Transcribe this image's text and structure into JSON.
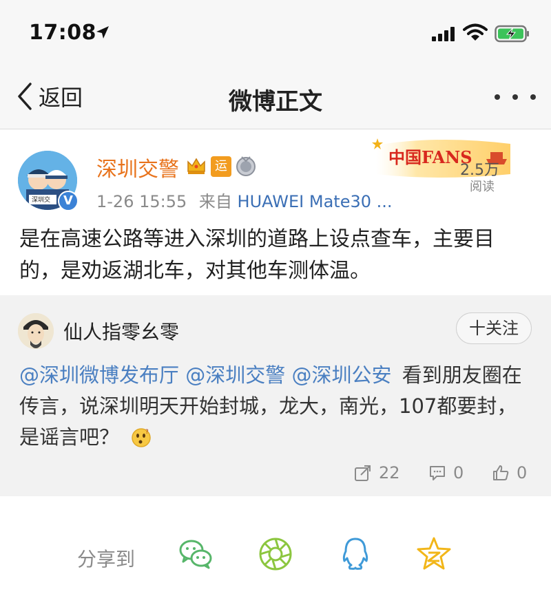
{
  "status_bar": {
    "time": "17:08"
  },
  "nav": {
    "back_label": "返回",
    "title": "微博正文"
  },
  "post": {
    "author": "深圳交警",
    "badge_yun": "运",
    "avatar_text": "深圳交",
    "verify_mark": "V",
    "time": "1-26 15:55",
    "source_prefix": "来自",
    "source": "HUAWEI Mate30 ...",
    "fans_banner_text": "中国FANS",
    "read_count": "2.5万",
    "read_label": "阅读",
    "text": "是在高速公路等进入深圳的道路上设点查车，主要目的，是劝返湖北车，对其他车测体温。"
  },
  "repost": {
    "user": "仙人指零幺零",
    "follow_label": "十关注",
    "mentions": [
      "@深圳微博发布厅",
      "@深圳交警",
      "@深圳公安"
    ],
    "text": "看到朋友圈在传言，说深圳明天开始封城，龙大，南光，107都要封，是谣言吧？",
    "repost_count": "22",
    "comment_count": "0",
    "like_count": "0"
  },
  "share": {
    "label": "分享到",
    "targets": [
      "wechat-icon",
      "moments-icon",
      "qq-icon",
      "qzone-icon"
    ]
  },
  "colors": {
    "author": "#e8731c",
    "link": "#3b6fb5",
    "mention": "#4a7fc1",
    "wechat": "#57b66a",
    "moments": "#8cc63f",
    "qq": "#3f9ad8",
    "qzone": "#f2b619"
  }
}
